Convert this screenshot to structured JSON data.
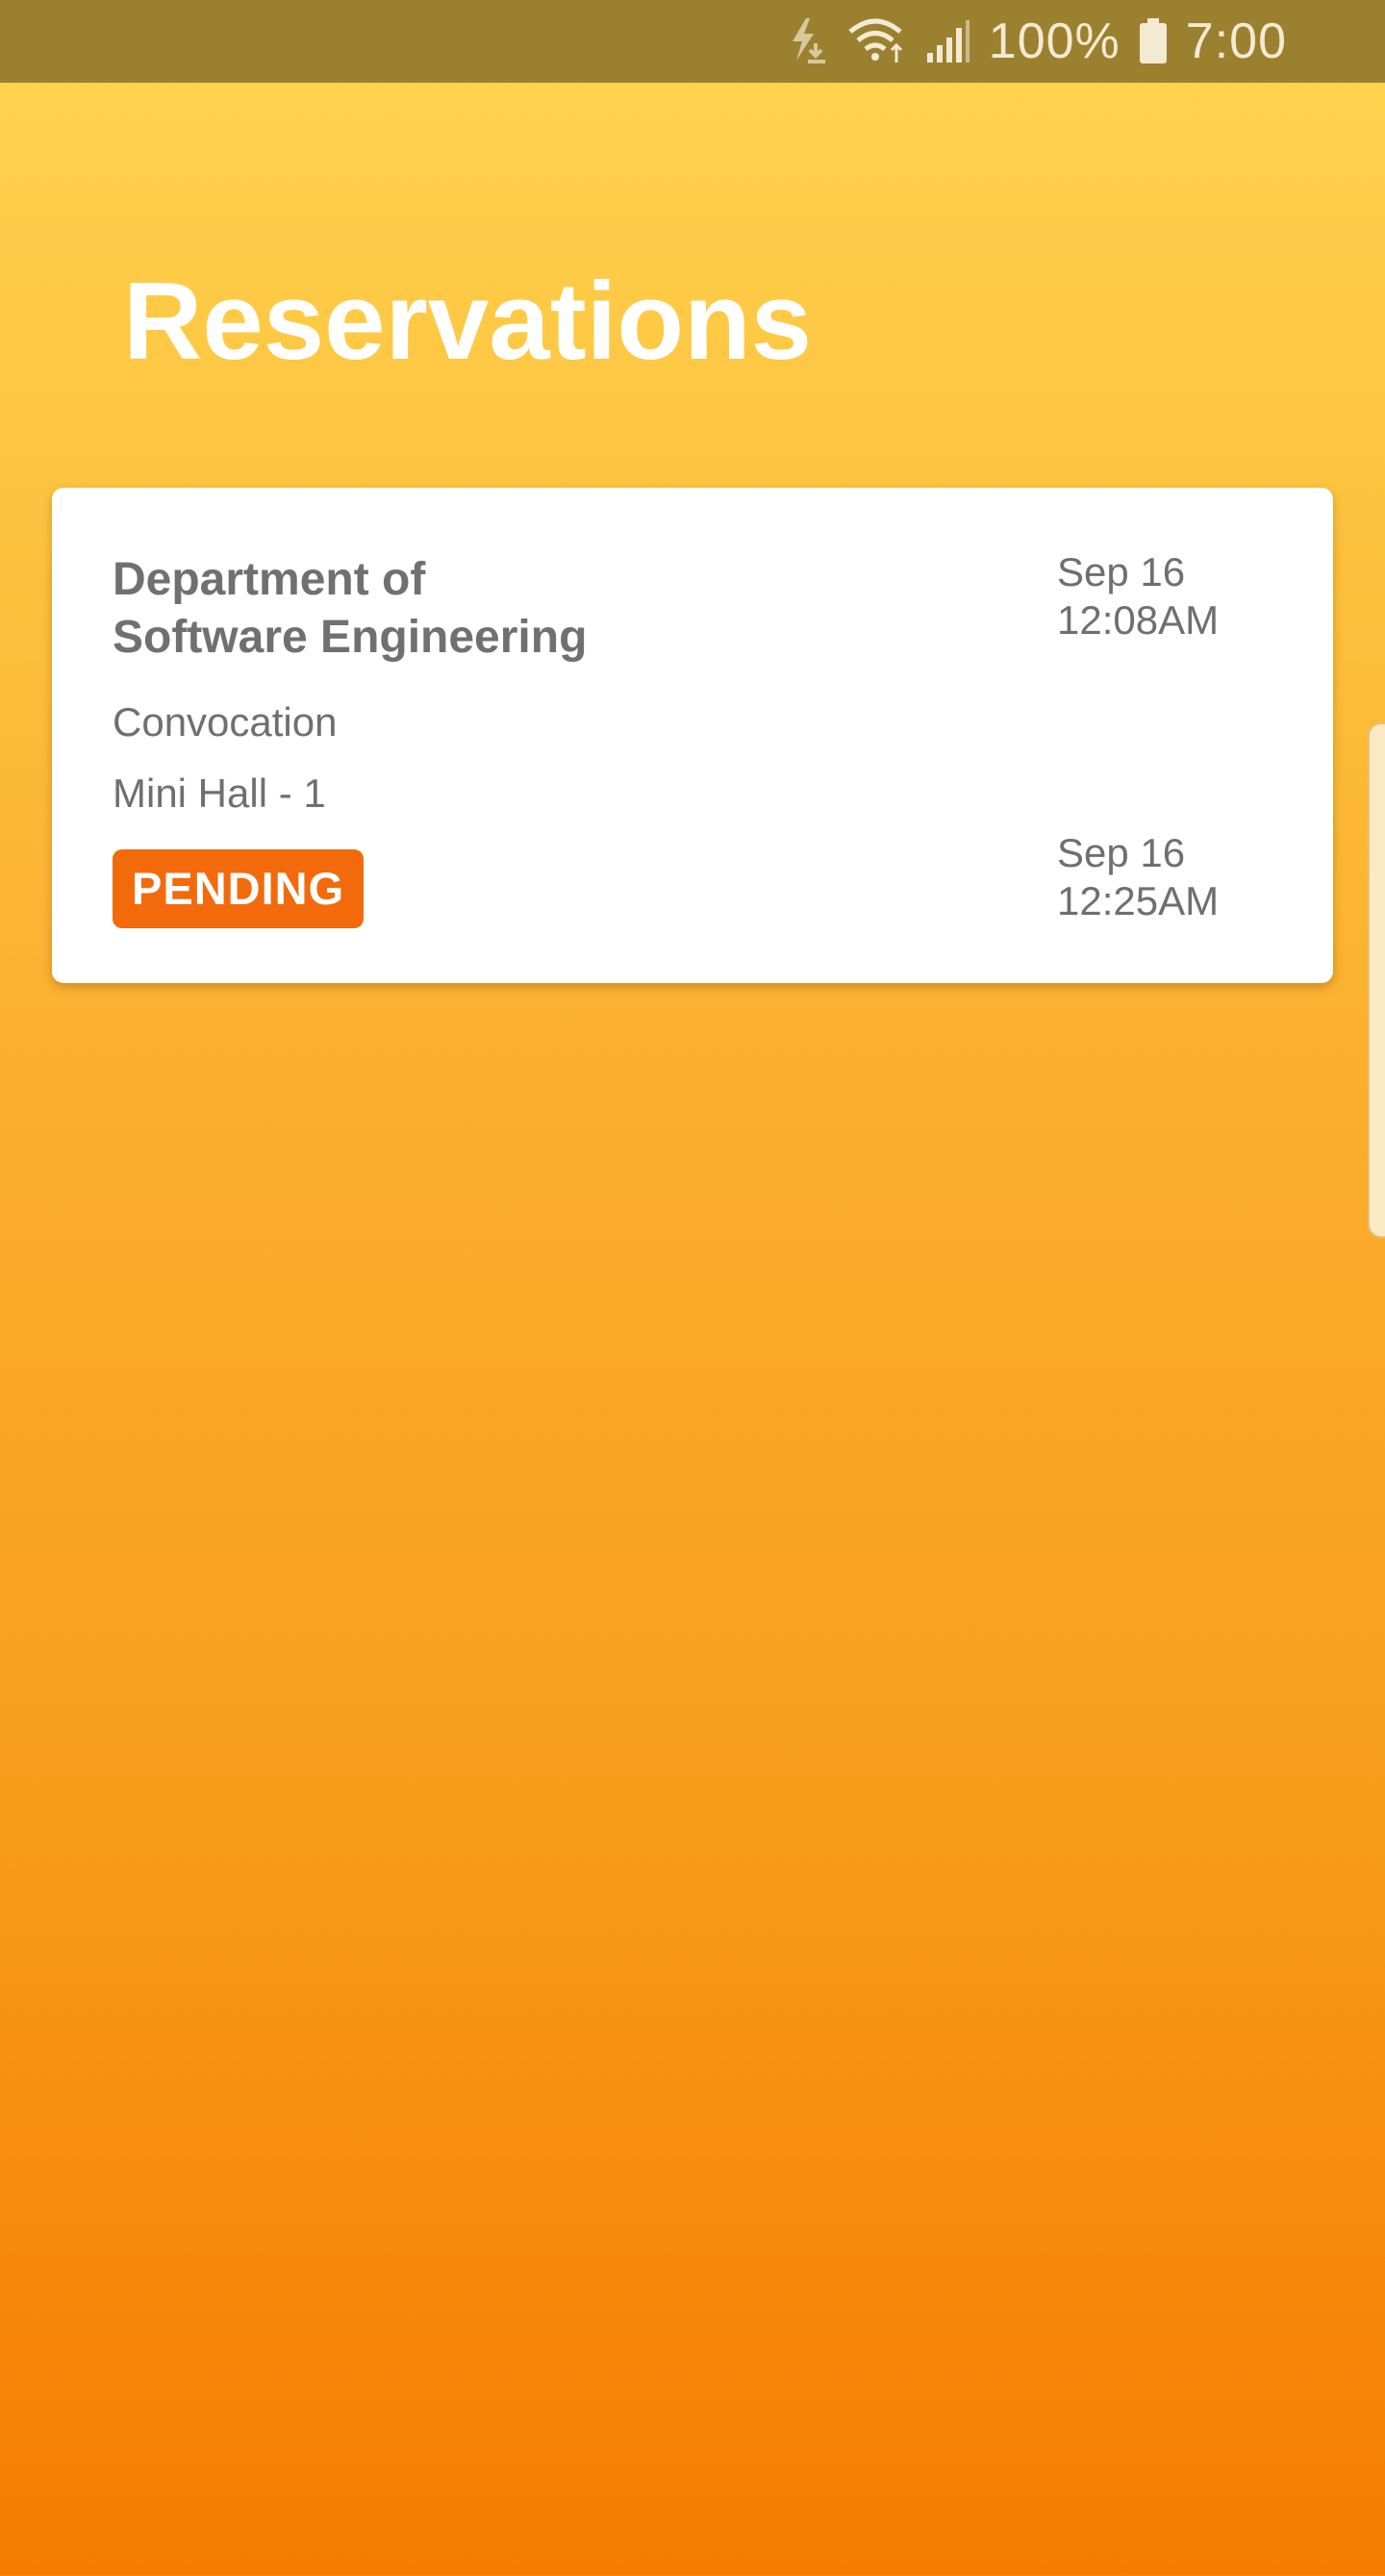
{
  "status_bar": {
    "battery_text": "100%",
    "time": "7:00",
    "icons": [
      "flash-download-icon",
      "wifi-icon",
      "signal-icon",
      "battery-icon"
    ],
    "color": "#9b8030"
  },
  "page": {
    "title": "Reservations",
    "gradient_top": "#ffd54f",
    "gradient_bottom": "#f57c00"
  },
  "reservations": [
    {
      "organization_line1": "Department of",
      "organization_line2": "Software Engineering",
      "event": "Convocation",
      "venue": "Mini Hall - 1",
      "status": "PENDING",
      "status_color": "#f26a0b",
      "start_date": "Sep 16",
      "start_time": "12:08AM",
      "end_date": "Sep 16",
      "end_time": "12:25AM"
    }
  ]
}
